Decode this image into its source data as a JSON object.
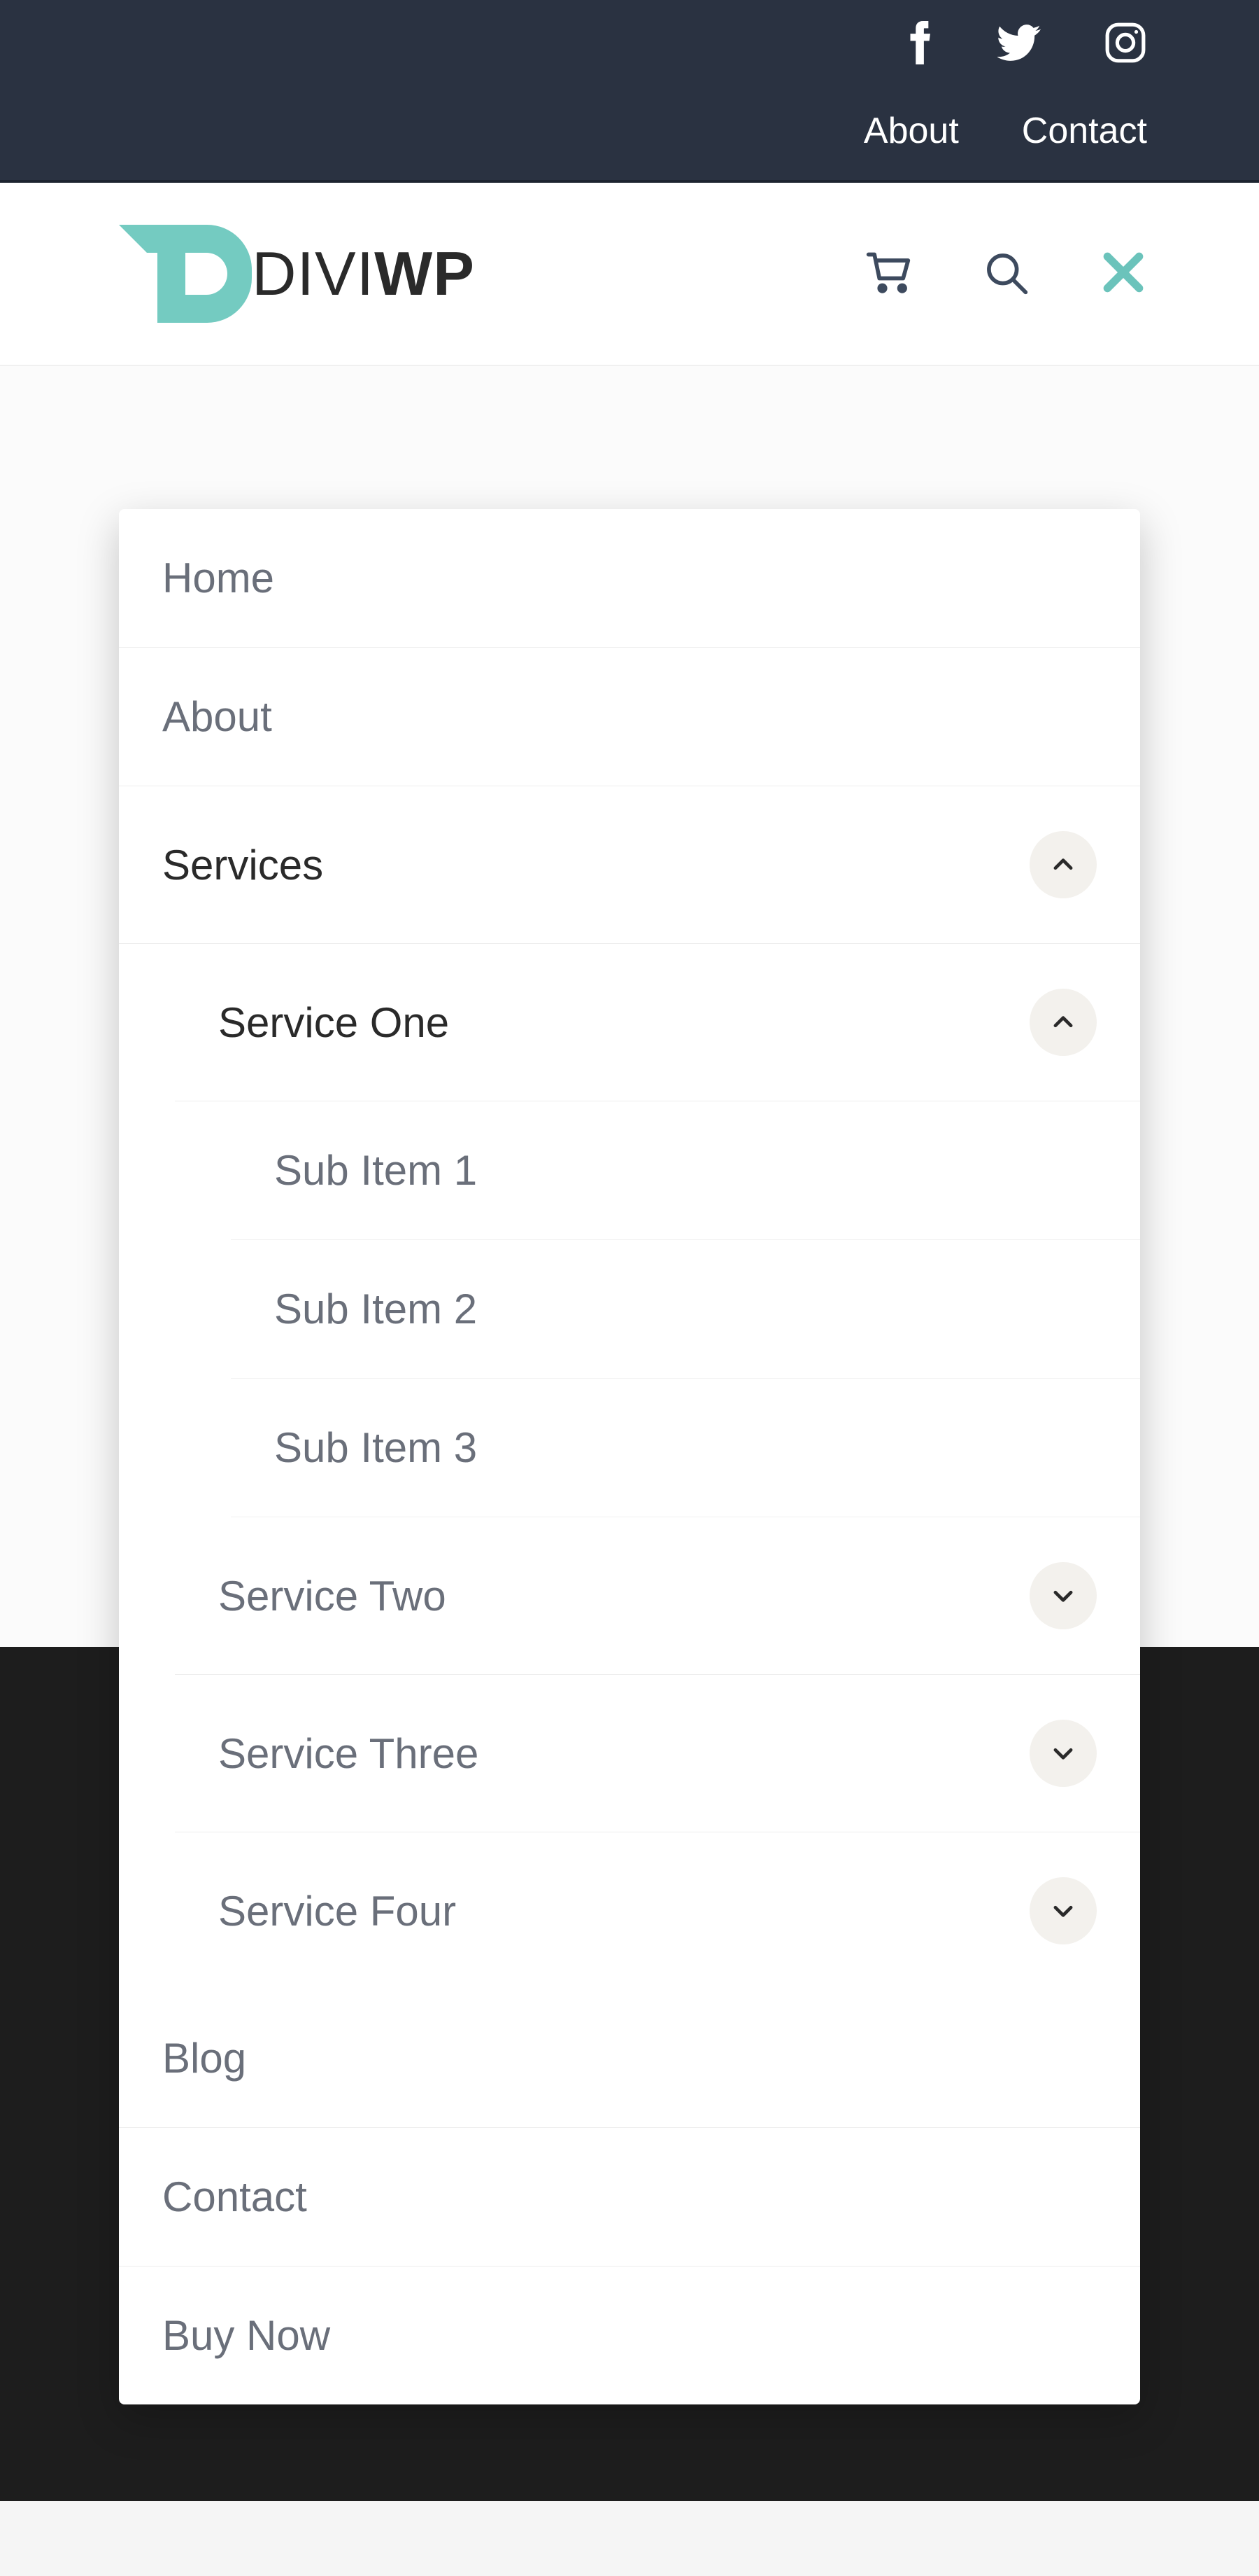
{
  "topbar": {
    "links": {
      "about": "About",
      "contact": "Contact"
    }
  },
  "logo": {
    "thin": "DIVI",
    "bold": "WP"
  },
  "menu": {
    "home": "Home",
    "about": "About",
    "services": {
      "label": "Services",
      "items": [
        {
          "label": "Service One",
          "expanded": true,
          "children": [
            "Sub Item 1",
            "Sub Item 2",
            "Sub Item 3"
          ]
        },
        {
          "label": "Service Two",
          "expanded": false
        },
        {
          "label": "Service Three",
          "expanded": false
        },
        {
          "label": "Service Four",
          "expanded": false
        }
      ]
    },
    "blog": "Blog",
    "contact": "Contact",
    "buy_now": "Buy Now"
  }
}
